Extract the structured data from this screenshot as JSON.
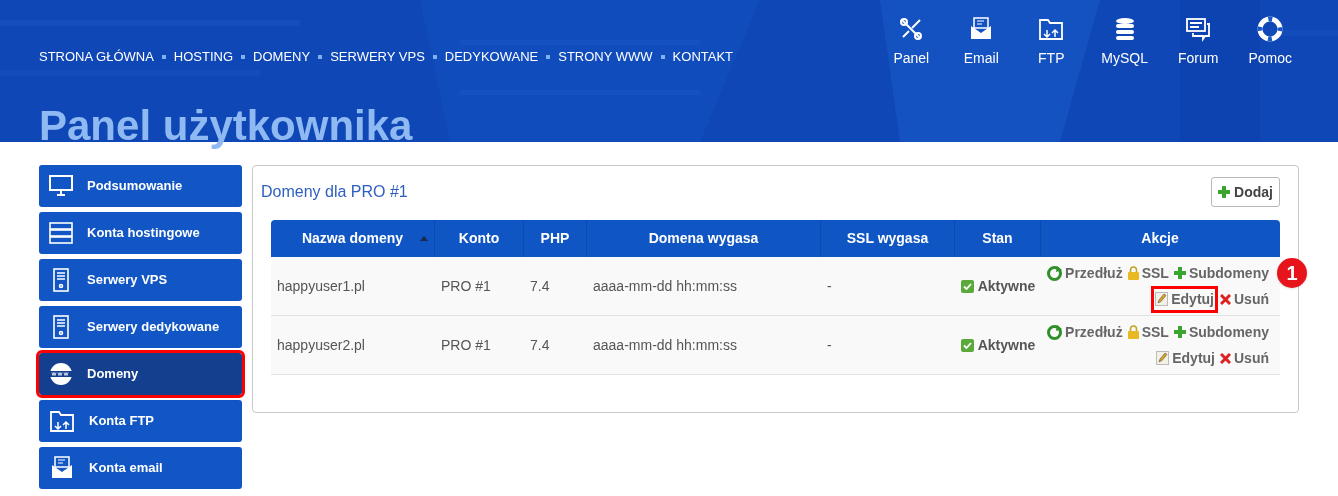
{
  "nav": {
    "links": [
      "STRONA GŁÓWNA",
      "HOSTING",
      "DOMENY",
      "SERWERY VPS",
      "DEDYKOWANE",
      "STRONY WWW",
      "KONTAKT"
    ],
    "shortcuts": [
      {
        "label": "Panel",
        "kind": "tools"
      },
      {
        "label": "Email",
        "kind": "mail"
      },
      {
        "label": "FTP",
        "kind": "folder"
      },
      {
        "label": "MySQL",
        "kind": "database"
      },
      {
        "label": "Forum",
        "kind": "chat"
      },
      {
        "label": "Pomoc",
        "kind": "lifebuoy"
      }
    ]
  },
  "page_title": "Panel użytkownika",
  "sidebar": {
    "items": [
      {
        "label": "Podsumowanie",
        "kind": "monitor",
        "selected": false,
        "highlighted": false
      },
      {
        "label": "Konta hostingowe",
        "kind": "rack",
        "selected": false,
        "highlighted": false
      },
      {
        "label": "Serwery VPS",
        "kind": "tower",
        "selected": false,
        "highlighted": false
      },
      {
        "label": "Serwery dedykowane",
        "kind": "tower",
        "selected": false,
        "highlighted": false
      },
      {
        "label": "Domeny",
        "kind": "www",
        "selected": true,
        "highlighted": true
      },
      {
        "label": "Konta FTP",
        "kind": "folder",
        "selected": false,
        "highlighted": false
      },
      {
        "label": "Konta email",
        "kind": "mail",
        "selected": false,
        "highlighted": false
      }
    ]
  },
  "panel": {
    "title": "Domeny dla PRO #1",
    "add_button": "Dodaj",
    "table": {
      "columns": [
        {
          "label": "Nazwa domeny",
          "sorted": true
        },
        {
          "label": "Konto",
          "sorted": false
        },
        {
          "label": "PHP",
          "sorted": false
        },
        {
          "label": "Domena wygasa",
          "sorted": false
        },
        {
          "label": "SSL wygasa",
          "sorted": false
        },
        {
          "label": "Stan",
          "sorted": false
        },
        {
          "label": "Akcje",
          "sorted": false
        }
      ],
      "rows": [
        {
          "domain": "happyuser1.pl",
          "account": "PRO #1",
          "php": "7.4",
          "expires": "aaaa-mm-dd hh:mm:ss",
          "ssl_expires": "-",
          "status": "Aktywne",
          "actions": {
            "renew": "Przedłuż",
            "ssl": "SSL",
            "subdomains": "Subdomeny",
            "edit": "Edytuj",
            "delete": "Usuń"
          },
          "edit_highlighted": true,
          "badge": "1"
        },
        {
          "domain": "happyuser2.pl",
          "account": "PRO #1",
          "php": "7.4",
          "expires": "aaaa-mm-dd hh:mm:ss",
          "ssl_expires": "-",
          "status": "Aktywne",
          "actions": {
            "renew": "Przedłuż",
            "ssl": "SSL",
            "subdomains": "Subdomeny",
            "edit": "Edytuj",
            "delete": "Usuń"
          },
          "edit_highlighted": false
        }
      ]
    }
  }
}
